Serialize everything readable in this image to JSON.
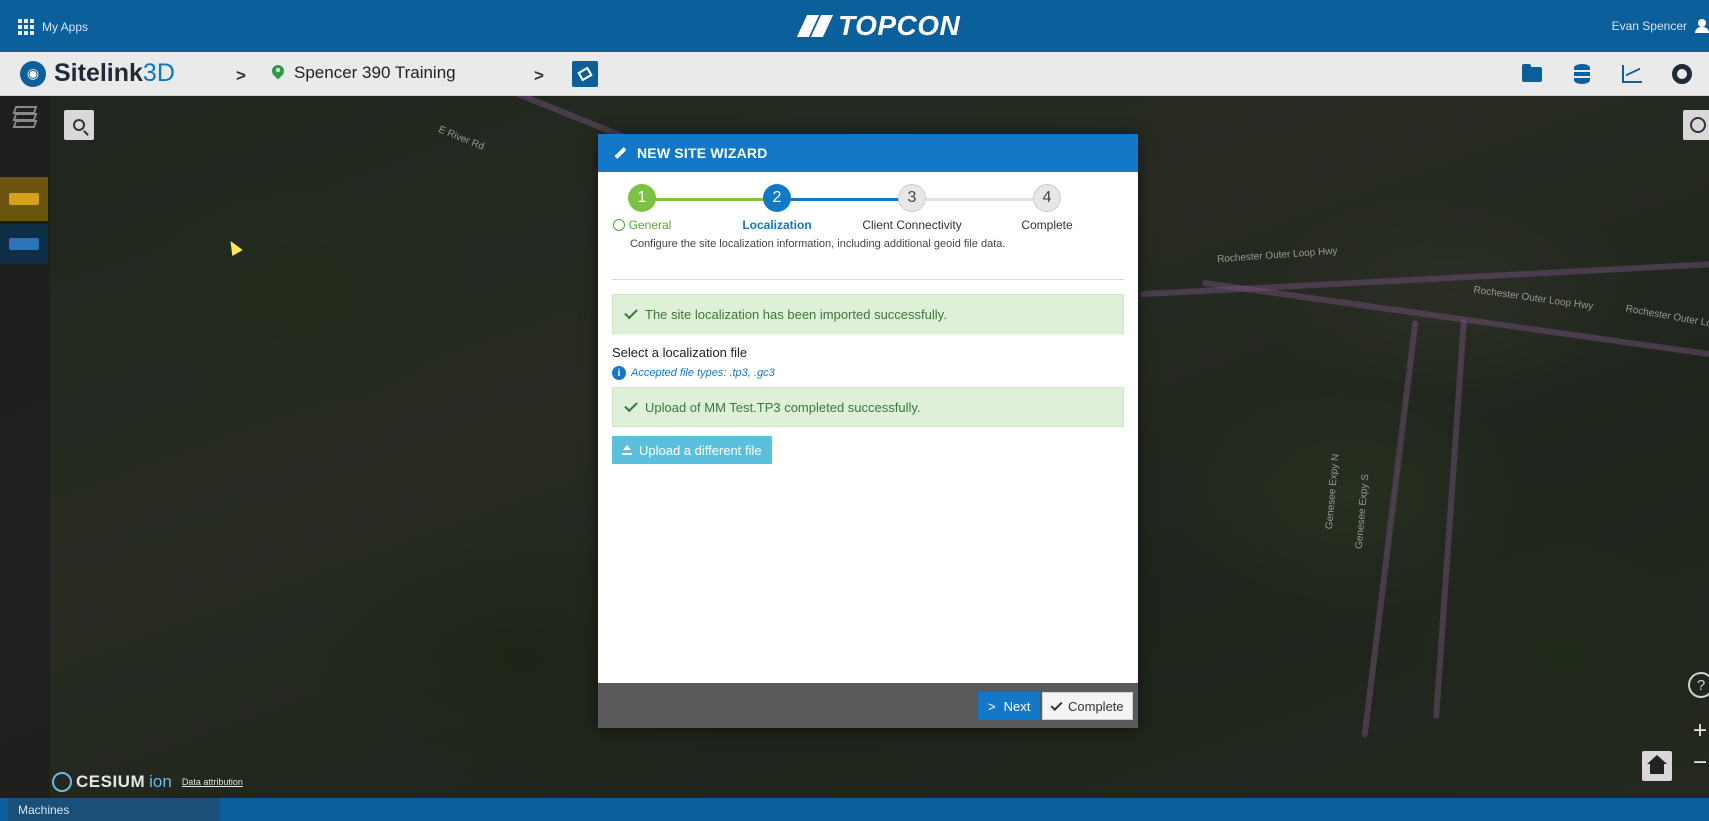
{
  "topbar": {
    "apps_label": "My Apps",
    "brand": "TOPCON",
    "user_name": "Evan Spencer"
  },
  "subbar": {
    "app_name": "Sitelink",
    "app_suffix": "3D",
    "chevron": ">",
    "project_name": "Spencer 390 Training"
  },
  "map": {
    "road_labels": [
      "Rochester Outer Loop Hwy",
      "Rochester Outer Loop Hwy",
      "Rochester Outer Lo",
      "E River Rd",
      "Genesee Expy N",
      "Genesee Expy S"
    ],
    "attribution_logo": "CESIUM",
    "attribution_ion": "ion",
    "attribution_link": "Data attribution",
    "help_glyph": "?",
    "zoom_in_glyph": "+",
    "zoom_out_glyph": "−"
  },
  "bottombar": {
    "machines_tab": "Machines"
  },
  "wizard": {
    "title": "NEW SITE WIZARD",
    "steps": [
      {
        "number": "1",
        "label": "General",
        "state": "done"
      },
      {
        "number": "2",
        "label": "Localization",
        "state": "active"
      },
      {
        "number": "3",
        "label": "Client Connectivity",
        "state": "todo"
      },
      {
        "number": "4",
        "label": "Complete",
        "state": "todo"
      }
    ],
    "description": "Configure the site localization information, including additional geoid file data.",
    "import_success": "The site localization has been imported successfully.",
    "select_label": "Select a localization file",
    "accepted_types": "Accepted file types: .tp3, .gc3",
    "info_glyph": "i",
    "upload_success": "Upload of MM Test.TP3 completed successfully.",
    "upload_button": "Upload a different file",
    "next_button": "Next",
    "next_chevron": ">",
    "complete_button": "Complete"
  },
  "colors": {
    "brand_blue": "#0b5f9a",
    "wizard_blue": "#1378c8",
    "success_green": "#7dc242",
    "upload_cyan": "#5bc0de"
  }
}
